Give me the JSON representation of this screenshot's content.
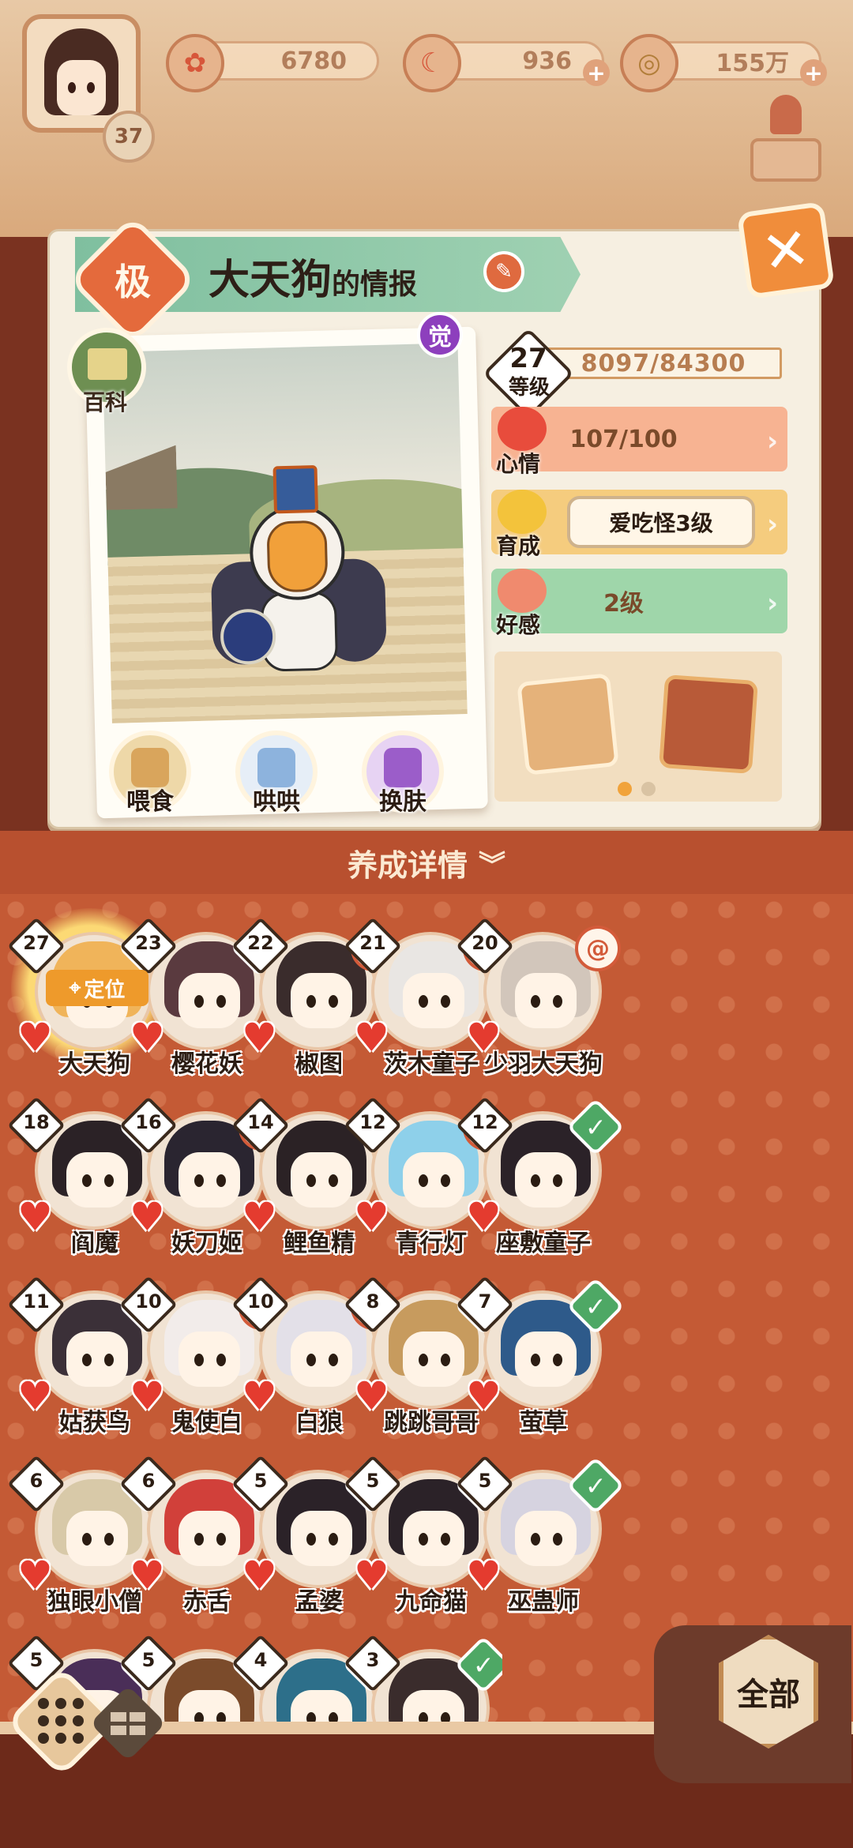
{
  "resources": {
    "player_level": "37",
    "items": [
      {
        "icon": "plum-blossom-icon",
        "value": "6780"
      },
      {
        "icon": "magatama-icon",
        "value": "936"
      },
      {
        "icon": "coin-icon",
        "value": "155万"
      }
    ]
  },
  "info": {
    "rank": "极",
    "name": "大天狗",
    "name_suffix": "的情报",
    "awaken_badge": "觉",
    "wiki_label": "百科",
    "level": "27",
    "level_label": "等级",
    "exp": "8097/84300",
    "mood_label": "心情",
    "mood_value": "107/100",
    "growth_label": "育成",
    "growth_value": "爱吃怪3级",
    "affection_label": "好感",
    "affection_value": "2级",
    "actions": [
      {
        "label": "喂食",
        "icon": "food-bowl-icon"
      },
      {
        "label": "哄哄",
        "icon": "milk-carton-icon"
      },
      {
        "label": "换肤",
        "icon": "kimono-icon"
      }
    ]
  },
  "detail_header": "养成详情",
  "locate_label": "定位",
  "roster": [
    {
      "level": "27",
      "name": "大天狗",
      "status": "done",
      "hair": "#f0b45a"
    },
    {
      "level": "23",
      "name": "樱花妖",
      "status": "done",
      "hair": "#5a3a3f"
    },
    {
      "level": "22",
      "name": "椒图",
      "status": "spiral",
      "hair": "#3a2c2c"
    },
    {
      "level": "21",
      "name": "茨木童子",
      "status": "spiral",
      "hair": "#e9e6e3"
    },
    {
      "level": "20",
      "name": "少羽大天狗",
      "status": "spiral",
      "hair": "#d2c6bb"
    },
    {
      "level": "18",
      "name": "阎魔",
      "status": "done",
      "hair": "#2b2226"
    },
    {
      "level": "16",
      "name": "妖刀姬",
      "status": "spiral",
      "hair": "#2a2530"
    },
    {
      "level": "14",
      "name": "鲤鱼精",
      "status": "none",
      "hair": "#2b2225"
    },
    {
      "level": "12",
      "name": "青行灯",
      "status": "spiral",
      "hair": "#8ed0ea"
    },
    {
      "level": "12",
      "name": "座敷童子",
      "status": "done",
      "hair": "#2b2228"
    },
    {
      "level": "11",
      "name": "姑获鸟",
      "status": "done",
      "hair": "#3b3038"
    },
    {
      "level": "10",
      "name": "鬼使白",
      "status": "spiral",
      "hair": "#f2ecea"
    },
    {
      "level": "10",
      "name": "白狼",
      "status": "spiral",
      "hair": "#e3e0e8"
    },
    {
      "level": "8",
      "name": "跳跳哥哥",
      "status": "done",
      "hair": "#c79b5e"
    },
    {
      "level": "7",
      "name": "萤草",
      "status": "done",
      "hair": "#2e5a8a"
    },
    {
      "level": "6",
      "name": "独眼小僧",
      "status": "done",
      "hair": "#d8c9a8"
    },
    {
      "level": "6",
      "name": "赤舌",
      "status": "done",
      "hair": "#d1403a"
    },
    {
      "level": "5",
      "name": "孟婆",
      "status": "done",
      "hair": "#2b2228"
    },
    {
      "level": "5",
      "name": "九命猫",
      "status": "done",
      "hair": "#2b2228"
    },
    {
      "level": "5",
      "name": "巫蛊师",
      "status": "done",
      "hair": "#d6d3e0"
    },
    {
      "level": "5",
      "name": "",
      "status": "done",
      "hair": "#4a2e58"
    },
    {
      "level": "5",
      "name": "",
      "status": "done",
      "hair": "#7b4b2b"
    },
    {
      "level": "4",
      "name": "",
      "status": "done",
      "hair": "#2d6f8a"
    },
    {
      "level": "3",
      "name": "",
      "status": "done",
      "hair": "#3a2c2c"
    }
  ],
  "filter_label": "全部",
  "colors": {
    "mood_row": "#f7b392",
    "growth_row": "#f5cc7e",
    "affection_row": "#9fd6aa",
    "accent": "#c45a35"
  }
}
